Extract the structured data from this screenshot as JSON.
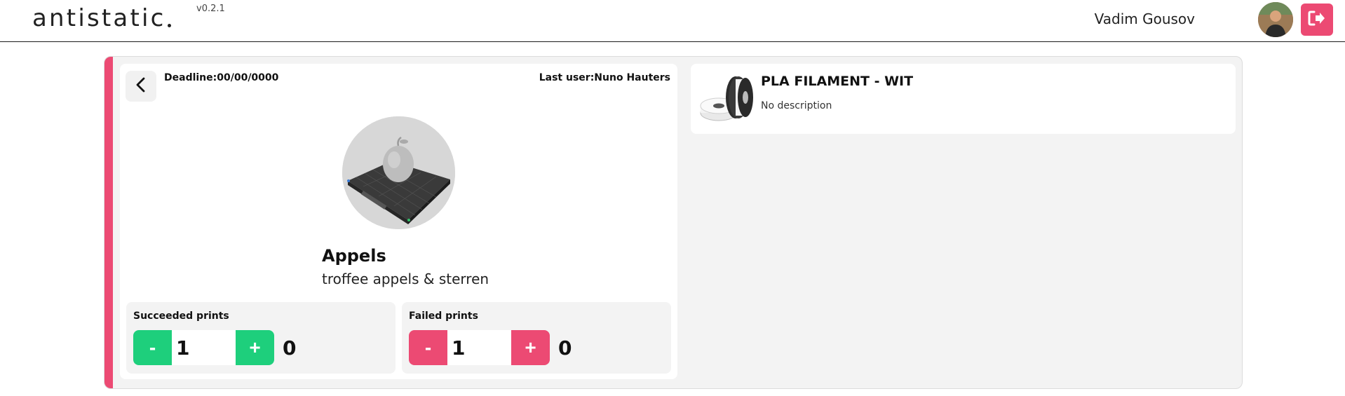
{
  "app": {
    "logo_text": "antistatic",
    "version": "v0.2.1"
  },
  "user": {
    "name": "Vadim Gousov"
  },
  "colors": {
    "accent_pink": "#ec4a73",
    "success_green": "#1ecf7c",
    "panel_gray": "#f3f3f3"
  },
  "print": {
    "deadline": "Deadline:00/00/0000",
    "last_user": "Last user:Nuno Hauters",
    "title": "Appels",
    "description": "troffee appels & sterren"
  },
  "counters": {
    "succeeded": {
      "label": "Succeeded prints",
      "minus": "-",
      "plus": "+",
      "step_value": "1",
      "count": "0"
    },
    "failed": {
      "label": "Failed prints",
      "minus": "-",
      "plus": "+",
      "step_value": "1",
      "count": "0"
    }
  },
  "material": {
    "title": "PLA FILAMENT - WIT",
    "description": "No description"
  },
  "icons": {
    "back": "chevron-left-icon",
    "logout": "logout-icon"
  }
}
